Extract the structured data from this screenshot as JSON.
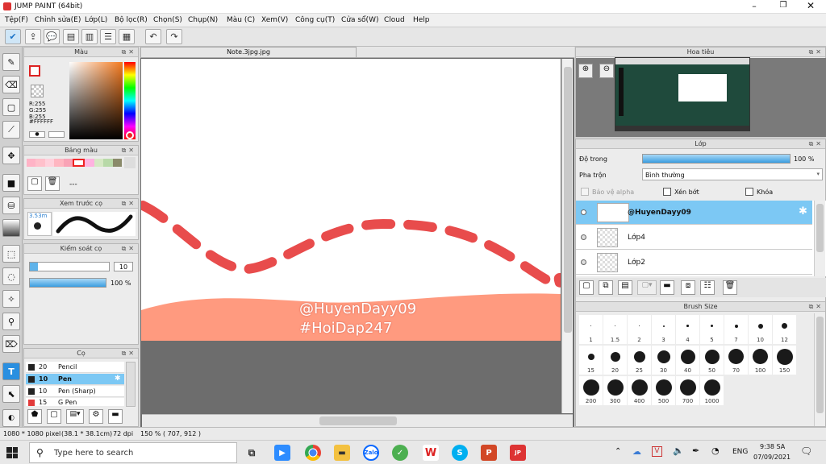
{
  "app": {
    "title": "JUMP PAINT (64bit)"
  },
  "menu": [
    "Tệp(F)",
    "Chỉnh sửa(E)",
    "Lớp(L)",
    "Bộ lọc(R)",
    "Chọn(S)",
    "Chụp(N)",
    "Màu (C)",
    "Xem(V)",
    "Công cụ(T)",
    "Cửa sổ(W)",
    "Cloud",
    "Help"
  ],
  "color_panel": {
    "title": "Màu",
    "r": "R:255",
    "g": "G:255",
    "b": "B:255",
    "hex": "#FFFFFF"
  },
  "swatch_panel": {
    "title": "Bảng màu",
    "dashes": "---"
  },
  "brush_preview": {
    "title": "Xem trước cọ",
    "size": "3.53m"
  },
  "brush_control": {
    "title": "Kiểm soát cọ",
    "size_value": "10",
    "opacity_value": "100 %",
    "opacity_level": 1.0
  },
  "brush_list": {
    "title": "Cọ",
    "items": [
      {
        "size": "20",
        "name": "Pencil",
        "color": "#222222",
        "selected": false
      },
      {
        "size": "10",
        "name": "Pen",
        "color": "#222222",
        "selected": true
      },
      {
        "size": "10",
        "name": "Pen (Sharp)",
        "color": "#222222",
        "selected": false
      },
      {
        "size": "15",
        "name": "G Pen",
        "color": "#e23b3b",
        "selected": false
      }
    ]
  },
  "document": {
    "tab": "Note.3jpg.jpg",
    "watermark1": "@HuyenDayy09",
    "watermark2": "#HoiDap247"
  },
  "navigator": {
    "title": "Hoa tiêu"
  },
  "layer_panel": {
    "title": "Lớp",
    "opacity_label": "Độ trong",
    "opacity_value": "100 %",
    "opacity_level": 1.0,
    "blend_label": "Pha trộn",
    "blend_value": "Bình thường",
    "protect_alpha": "Bảo vệ alpha",
    "clipping": "Xén bớt",
    "lock": "Khóa",
    "layers": [
      {
        "name": "@HuyenDayy09",
        "selected": true
      },
      {
        "name": "Lớp4",
        "selected": false
      },
      {
        "name": "Lớp2",
        "selected": false
      }
    ]
  },
  "brush_size_panel": {
    "title": "Brush Size",
    "sizes": [
      "1",
      "1.5",
      "2",
      "3",
      "4",
      "5",
      "7",
      "10",
      "12",
      "15",
      "20",
      "25",
      "30",
      "40",
      "50",
      "70",
      "100",
      "150",
      "200",
      "300",
      "400",
      "500",
      "700",
      "1000"
    ]
  },
  "status": {
    "dimensions": "1080 * 1080 pixel",
    "physical": "(38.1 * 38.1cm)",
    "dpi": "72 dpi",
    "zoom": "150 %",
    "coords": "( 707, 912 )"
  },
  "taskbar": {
    "search_placeholder": "Type here to search",
    "lang": "ENG",
    "time": "9:38 SA",
    "date": "07/09/2021"
  },
  "colors": {
    "accent": "#6ac0ee",
    "selected_row": "#7cc8f4",
    "dash_red": "#e84c4c",
    "salmon": "#ff9a7f"
  }
}
